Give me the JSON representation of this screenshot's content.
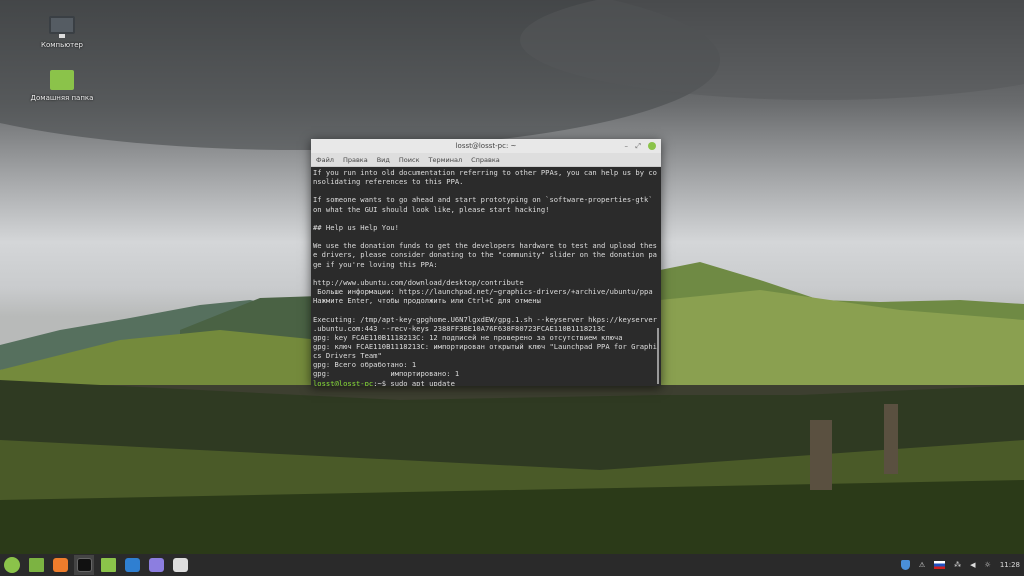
{
  "desktop": {
    "icons": [
      {
        "label": "Компьютер",
        "icon": "monitor-icon"
      },
      {
        "label": "Домашняя папка",
        "icon": "home-folder-icon"
      }
    ]
  },
  "terminal": {
    "title": "losst@losst-pc: ~",
    "menu": [
      "Файл",
      "Правка",
      "Вид",
      "Поиск",
      "Терминал",
      "Справка"
    ],
    "lines": [
      "If you run into old documentation referring to other PPAs, you can help us by co",
      "nsolidating references to this PPA.",
      "",
      "If someone wants to go ahead and start prototyping on `software-properties-gtk`",
      "on what the GUI should look like, please start hacking!",
      "",
      "## Help us Help You!",
      "",
      "We use the donation funds to get the developers hardware to test and upload thes",
      "e drivers, please consider donating to the \"community\" slider on the donation pa",
      "ge if you're loving this PPA:",
      "",
      "http://www.ubuntu.com/download/desktop/contribute",
      " Больше информации: https://launchpad.net/~graphics-drivers/+archive/ubuntu/ppa",
      "Нажмите Enter, чтобы продолжить или Ctrl+C для отмены",
      "",
      "Executing: /tmp/apt-key-gpghome.U6N7lgxdEW/gpg.1.sh --keyserver hkps://keyserver",
      ".ubuntu.com:443 --recv-keys 2388FF3BE10A76F638F80723FCAE110B1118213C",
      "gpg: key FCAE110B1118213C: 12 подписей не проверено за отсутствием ключа",
      "gpg: ключ FCAE110B1118213C: импортирован открытый ключ \"Launchpad PPA for Graphi",
      "cs Drivers Team\"",
      "gpg: Всего обработано: 1",
      "gpg:              импортировано: 1"
    ],
    "prompt": "losst@losst-pc",
    "prompt_suffix": ":~$ ",
    "command": "sudo apt update"
  },
  "panel": {
    "launchers": [
      "menu",
      "show-desktop",
      "firefox",
      "terminal",
      "files",
      "screenshot",
      "text-editor",
      "settings"
    ],
    "clock": "11:28"
  }
}
